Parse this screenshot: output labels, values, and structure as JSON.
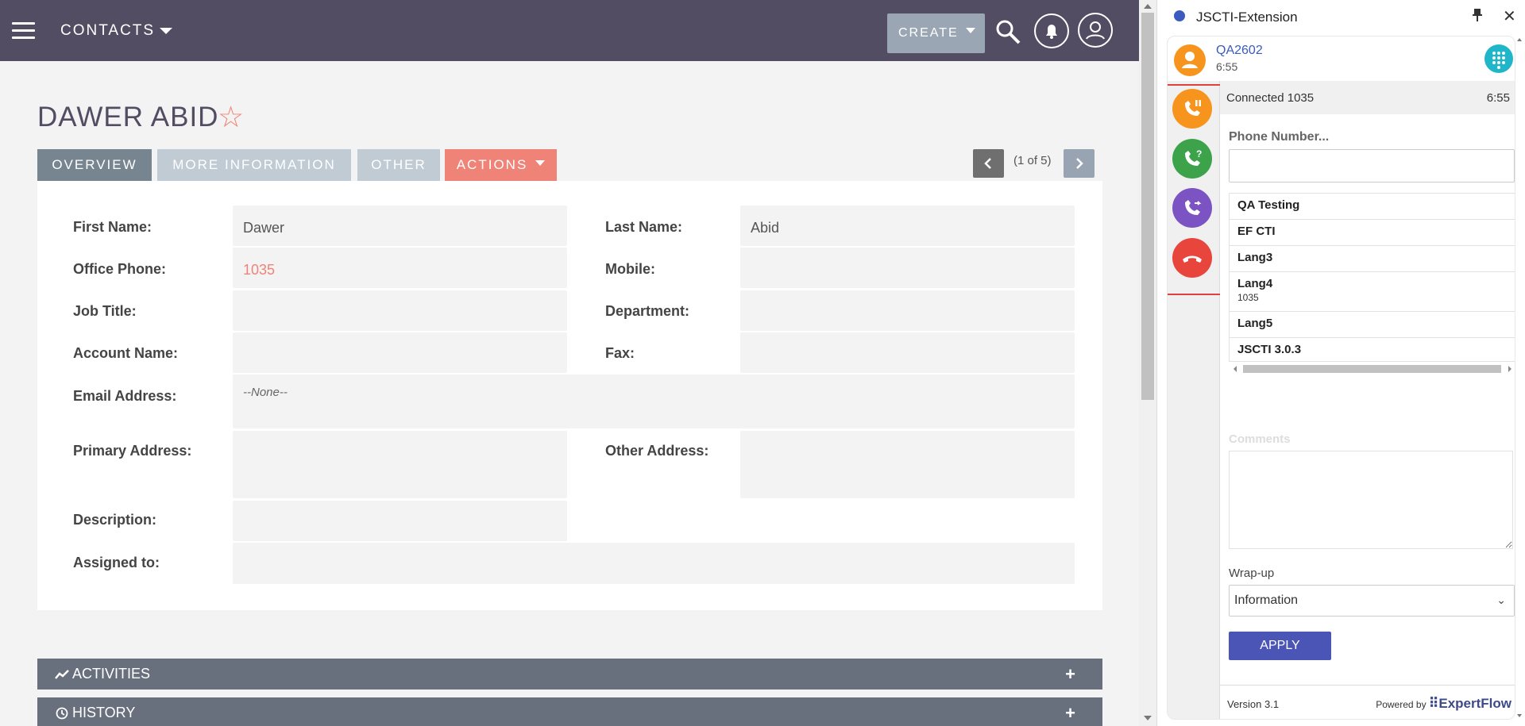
{
  "topbar": {
    "module": "CONTACTS",
    "create_label": "CREATE",
    "icons": [
      "menu-icon",
      "search-icon",
      "bell-icon",
      "user-icon"
    ]
  },
  "record": {
    "title": "DAWER ABID",
    "tabs": [
      "OVERVIEW",
      "MORE INFORMATION",
      "OTHER",
      "ACTIONS"
    ],
    "pager": "(1 of 5)"
  },
  "fields": {
    "first_name_label": "First Name:",
    "first_name": "Dawer",
    "last_name_label": "Last Name:",
    "last_name": "Abid",
    "office_phone_label": "Office Phone:",
    "office_phone": "1035",
    "mobile_label": "Mobile:",
    "job_title_label": "Job Title:",
    "department_label": "Department:",
    "account_name_label": "Account Name:",
    "fax_label": "Fax:",
    "email_label": "Email Address:",
    "email_value": "--None--",
    "primary_address_label": "Primary Address:",
    "other_address_label": "Other Address:",
    "description_label": "Description:",
    "assigned_to_label": "Assigned to:"
  },
  "subpanels": [
    "ACTIVITIES",
    "HISTORY"
  ],
  "colors": {
    "topbar": "#534d64",
    "accent": "#f08377",
    "tab_active": "#778591"
  },
  "extension": {
    "title": "JSCTI-Extension",
    "agent_name": "QA2602",
    "agent_time": "6:55",
    "connected_text": "Connected 1035",
    "connected_time": "6:55",
    "phone_label": "Phone Number...",
    "phone_placeholder": "",
    "list": [
      {
        "name": "QA Testing"
      },
      {
        "name": "EF CTI"
      },
      {
        "name": "Lang3"
      },
      {
        "name": "Lang4",
        "sub": "1035"
      },
      {
        "name": "Lang5"
      },
      {
        "name": "JSCTI 3.0.3"
      }
    ],
    "comments_label": "Comments",
    "wrapup_label": "Wrap-up",
    "wrapup_value": "Information",
    "apply_label": "APPLY",
    "version": "Version 3.1",
    "powered_by": "Powered by",
    "brand": "ExpertFlow",
    "controls": [
      "hold-call-icon",
      "consult-call-icon",
      "transfer-call-icon",
      "end-call-icon"
    ]
  }
}
